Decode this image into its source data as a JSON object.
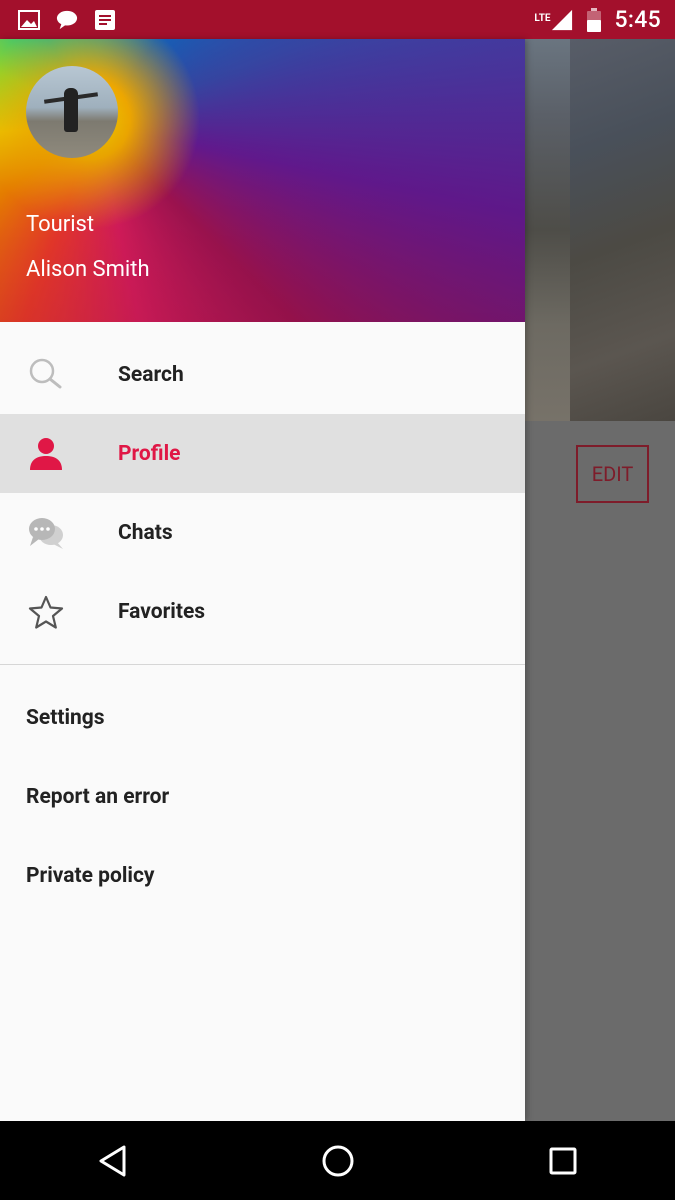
{
  "status_bar": {
    "time": "5:45",
    "network": "LTE",
    "left_icons": [
      "image-icon",
      "chat-bubble-icon",
      "notes-icon"
    ],
    "background_color": "#a3102c"
  },
  "drawer": {
    "header": {
      "role": "Tourist",
      "name": "Alison Smith"
    },
    "primary_items": [
      {
        "label": "Search",
        "icon": "search-icon",
        "active": false
      },
      {
        "label": "Profile",
        "icon": "person-icon",
        "active": true
      },
      {
        "label": "Chats",
        "icon": "chats-icon",
        "active": false
      },
      {
        "label": "Favorites",
        "icon": "star-icon",
        "active": false
      }
    ],
    "secondary_items": [
      {
        "label": "Settings"
      },
      {
        "label": "Report an error"
      },
      {
        "label": "Private policy"
      }
    ],
    "accent_color": "#e01746"
  },
  "background": {
    "edit_label": "EDIT"
  },
  "nav_bar": {
    "buttons": [
      "back-icon",
      "home-icon",
      "recents-icon"
    ]
  }
}
